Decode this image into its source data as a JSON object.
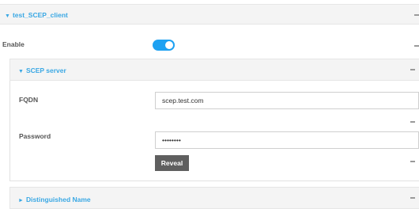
{
  "client_section": {
    "title": "test_SCEP_client",
    "expanded": true
  },
  "enable": {
    "label": "Enable",
    "value": true
  },
  "scep_server": {
    "title": "SCEP server",
    "expanded": true,
    "fqdn": {
      "label": "FQDN",
      "value": "scep.test.com"
    },
    "password": {
      "label": "Password",
      "value": "secretpw",
      "reveal_label": "Reveal"
    }
  },
  "distinguished_name": {
    "title": "Distinguished Name",
    "expanded": false
  },
  "colors": {
    "accent": "#3aa8e4",
    "toggle_on": "#1da1f2",
    "button": "#5f5f5f"
  },
  "icons": {
    "expanded": "triangle-down-icon",
    "collapsed": "triangle-right-icon",
    "menu": "dash-icon"
  }
}
